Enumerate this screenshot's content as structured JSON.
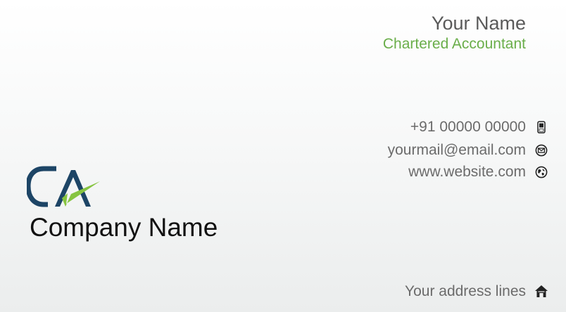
{
  "person": {
    "name": "Your Name",
    "title": "Chartered Accountant"
  },
  "contact": {
    "phone": "+91 00000 00000",
    "email": "yourmail@email.com",
    "website": "www.website.com",
    "address": "Your address lines"
  },
  "company": {
    "name": "Company Name",
    "logo_text": "CA"
  },
  "icons": {
    "phone": "mobile-phone-icon",
    "email": "email-icon",
    "website": "globe-icon",
    "address": "home-icon"
  },
  "colors": {
    "title_green": "#6aae4a",
    "logo_navy": "#1d4566",
    "logo_green": "#86c440",
    "name_gray": "#5a5a5a",
    "text_gray": "#6b6b6b",
    "company_black": "#111111"
  }
}
